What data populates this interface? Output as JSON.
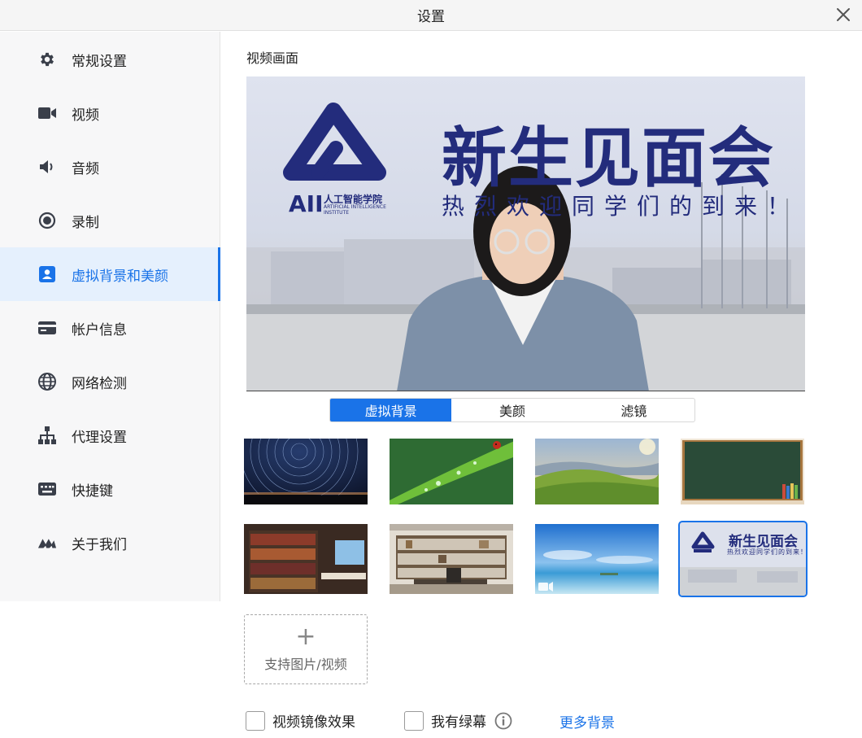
{
  "window": {
    "title": "设置"
  },
  "sidebar": {
    "items": [
      {
        "label": "常规设置",
        "icon": "gear-icon"
      },
      {
        "label": "视频",
        "icon": "video-camera-icon"
      },
      {
        "label": "音频",
        "icon": "speaker-icon"
      },
      {
        "label": "录制",
        "icon": "record-icon"
      },
      {
        "label": "虚拟背景和美颜",
        "icon": "portrait-icon",
        "active": true
      },
      {
        "label": "帐户信息",
        "icon": "card-icon"
      },
      {
        "label": "网络检测",
        "icon": "globe-icon"
      },
      {
        "label": "代理设置",
        "icon": "network-tree-icon"
      },
      {
        "label": "快捷键",
        "icon": "keyboard-icon"
      },
      {
        "label": "关于我们",
        "icon": "brand-logo-icon"
      }
    ]
  },
  "main": {
    "section_title": "视频画面",
    "preview": {
      "banner_title": "新生见面会",
      "banner_subtitle": "热烈欢迎同学们的到来！",
      "logo_letters": "AII",
      "logo_cn": "人工智能学院",
      "logo_en_1": "ARTIFICIAL INTELLIGENCE",
      "logo_en_2": "INSTITUTE"
    },
    "tabs": [
      {
        "label": "虚拟背景",
        "active": true
      },
      {
        "label": "美颜",
        "active": false
      },
      {
        "label": "滤镜",
        "active": false
      }
    ],
    "thumb_banner_title": "新生见面会",
    "thumb_banner_subtitle": "热烈欢迎同学们的到来！",
    "upload_label": "支持图片/视频",
    "mirror_label": "视频镜像效果",
    "greenscreen_label": "我有绿幕",
    "more_label": "更多背景"
  },
  "colors": {
    "accent": "#1a73e8",
    "brand_navy": "#232c7c",
    "icon_gray": "#3a3f4a"
  }
}
